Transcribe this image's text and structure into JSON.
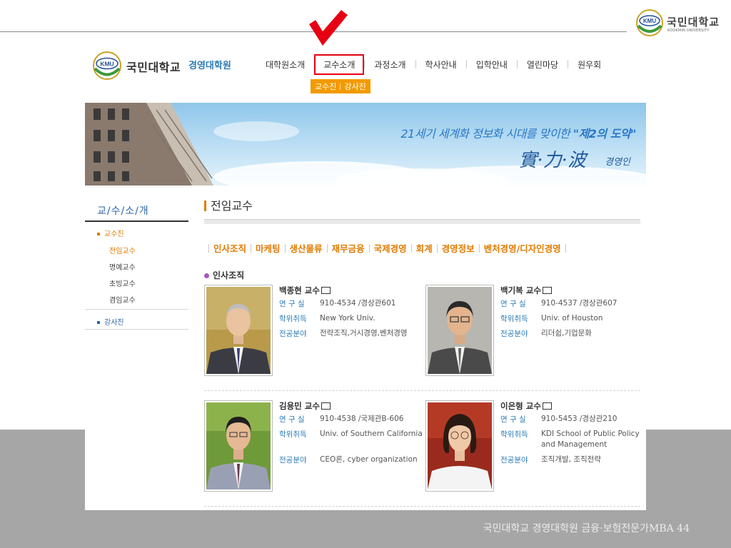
{
  "slide": {
    "logo_abbr": "KMU",
    "logo_name": "국민대학교",
    "logo_english": "KOOKMIN UNIVERSITY",
    "footer": "국민대학교 경영대학원 금융·보험전문가MBA 44"
  },
  "site": {
    "logo_abbr": "KMU",
    "logo_name": "국민대학교",
    "subtitle": "경영대학원",
    "nav": [
      "대학원소개",
      "교수소개",
      "과정소개",
      "학사안내",
      "입학안내",
      "열린마당",
      "원우회"
    ],
    "active_nav": "교수소개",
    "subtabs": [
      "교수진",
      "강사진"
    ]
  },
  "banner": {
    "quote_prefix": "21세기 세계화 정보화 시대를 맞이한 ",
    "quote_highlight": "\"제2의 도약\"",
    "motto": "實·力·波",
    "motto_sub": "경영인"
  },
  "sidebar": {
    "title": "교/수/소/개",
    "category": "교수진",
    "items": [
      "전임교수",
      "명예교수",
      "초빙교수",
      "겸임교수"
    ],
    "current_item": "전임교수",
    "category2": "강사진"
  },
  "main": {
    "title": "전임교수",
    "fields": [
      "인사조직",
      "마케팅",
      "생산물류",
      "재무금융",
      "국제경영",
      "회계",
      "경영정보",
      "벤처경영/디자인경영"
    ],
    "section": "인사조직",
    "labels": {
      "office": "연 구 실",
      "degree": "학위취득",
      "field": "전공분야"
    },
    "professors": [
      {
        "name": "백종현 교수",
        "office": "910-4534 /경상관601",
        "degree": "New York Univ.",
        "field": "전략조직,거시경영,벤처경영"
      },
      {
        "name": "백기복 교수",
        "office": "910-4537 /경상관607",
        "degree": "Univ. of Houston",
        "field": "리더쉽,기업문화"
      },
      {
        "name": "김용민 교수",
        "office": "910-4538 /국제관B-606",
        "degree": "Univ. of Southern California",
        "field": "CEO론, cyber organization"
      },
      {
        "name": "이은형 교수",
        "office": "910-5453 /경상관210",
        "degree": "KDI School of Public Policy and Management",
        "field": "조직개발, 조직전략"
      }
    ]
  },
  "annotation": {
    "icon": "red-checkmark-icon",
    "color": "#e60012"
  }
}
